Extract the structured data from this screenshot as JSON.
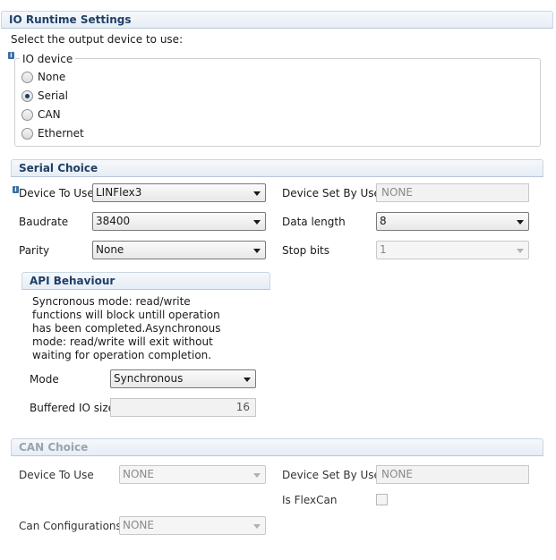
{
  "io_runtime": {
    "title": "IO Runtime Settings",
    "instruction": "Select the output device to use:",
    "group_title": "IO device",
    "options": [
      "None",
      "Serial",
      "CAN",
      "Ethernet"
    ],
    "selected": "Serial"
  },
  "serial": {
    "title": "Serial Choice",
    "device_label": "Device To Use",
    "device_value": "LINFlex3",
    "device_set_label": "Device Set By User",
    "device_set_value": "NONE",
    "baudrate_label": "Baudrate",
    "baudrate_value": "38400",
    "data_length_label": "Data length",
    "data_length_value": "8",
    "parity_label": "Parity",
    "parity_value": "None",
    "stop_bits_label": "Stop bits",
    "stop_bits_value": "1"
  },
  "api": {
    "title": "API Behaviour",
    "description": "Syncronous mode: read/write functions will block untill operation has been completed.Asynchronous mode: read/write will exit without waiting for operation completion.",
    "mode_label": "Mode",
    "mode_value": "Synchronous",
    "buffer_label": "Buffered IO size",
    "buffer_value": "16"
  },
  "can": {
    "title": "CAN Choice",
    "device_label": "Device To Use",
    "device_value": "NONE",
    "device_set_label": "Device Set By User",
    "device_set_value": "NONE",
    "flexcan_label": "Is FlexCan",
    "config_label": "Can Configurations",
    "config_value": "NONE"
  },
  "icons": {
    "info": "info-icon"
  },
  "colors": {
    "header_text": "#1f3f66",
    "selected_dot": "#1a3e6b"
  }
}
